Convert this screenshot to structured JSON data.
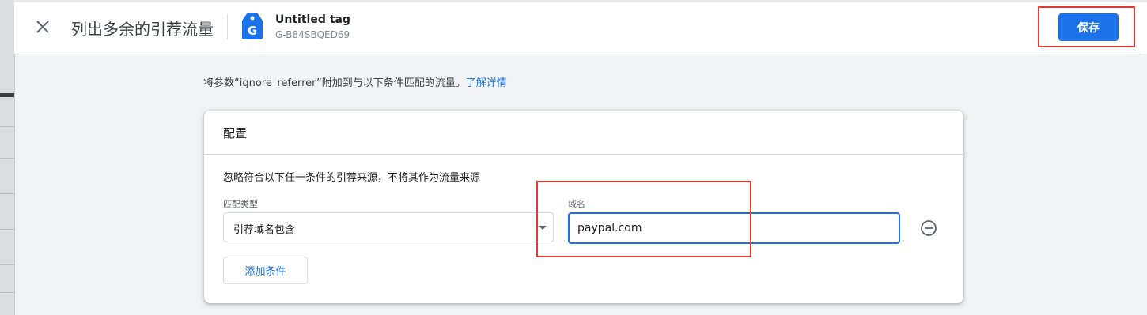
{
  "header": {
    "page_title": "列出多余的引荐流量",
    "tag_name": "Untitled tag",
    "tag_id": "G-B84SBQED69",
    "tag_icon_letter": "G",
    "save_label": "保存",
    "icons": [
      "close-icon",
      "tag-icon"
    ]
  },
  "description": {
    "text": "将参数“ignore_referrer”附加到与以下条件匹配的流量。",
    "link": "了解详情"
  },
  "config": {
    "title": "配置",
    "subtitle": "忽略符合以下任一条件的引荐来源，不将其作为流量来源",
    "match_type_label": "匹配类型",
    "match_type_value": "引荐域名包含",
    "domain_label": "域名",
    "domain_value": "paypal.com",
    "add_condition_label": "添加条件",
    "icons": [
      "remove-circle-icon",
      "dropdown-arrow-icon"
    ]
  },
  "colors": {
    "accent": "#1a73e8",
    "highlight": "#e53935",
    "background": "#f1f3f4"
  }
}
